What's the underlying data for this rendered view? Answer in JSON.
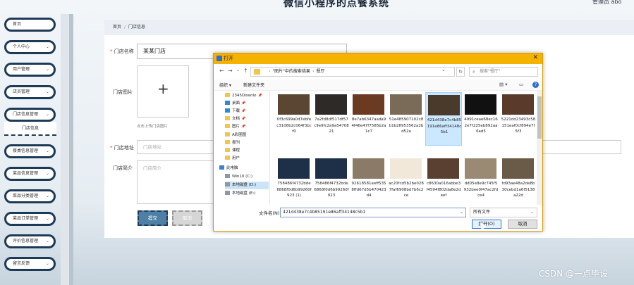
{
  "app": {
    "title": "微信小程序的点餐系统",
    "admin": "管理员 abo"
  },
  "sidebar": {
    "items": [
      {
        "label": "首页",
        "chevron": ""
      },
      {
        "label": "个人中心",
        "chevron": "⌄"
      },
      {
        "label": "用户管理",
        "chevron": "⌄"
      },
      {
        "label": "店员管理",
        "chevron": "⌄"
      },
      {
        "label": "门店信息管理",
        "chevron": "⌄"
      },
      {
        "label": "餐桌信息管理",
        "chevron": "⌄"
      },
      {
        "label": "菜品信息管理",
        "chevron": "⌄"
      },
      {
        "label": "菜品分类管理",
        "chevron": "⌄"
      },
      {
        "label": "菜品订单管理",
        "chevron": "⌄"
      },
      {
        "label": "评价信息管理",
        "chevron": "⌄"
      },
      {
        "label": "留言反馈",
        "chevron": "⌄"
      }
    ],
    "sub_item": "门店信息"
  },
  "breadcrumb": {
    "home": "首页",
    "sep": "/",
    "current": "门店信息"
  },
  "form": {
    "name_label": "门店名称",
    "name_value": "某某门店",
    "image_label": "门店图片",
    "upload_plus": "+",
    "upload_hint": "点击上传门店图片",
    "address_label": "门店地址",
    "address_placeholder": "门店地址",
    "intro_label": "门店简介",
    "intro_placeholder": "门店简介",
    "required_mark": "*",
    "submit": "提交",
    "cancel": "取消"
  },
  "dialog": {
    "title": "打开",
    "close": "✕",
    "nav": {
      "back": "←",
      "forward": "→",
      "dropdown": "⌄",
      "up": "↑"
    },
    "path": [
      "\"图片\"中的搜索结果",
      "餐厅"
    ],
    "path_sep": "›",
    "refresh": "↻",
    "search_placeholder": "搜索\"餐厅\"",
    "search_icon": "⌕",
    "toolbar": {
      "organize": "组织 ▾",
      "new_folder": "新建文件夹",
      "view": "▤ ▾",
      "pane": "▭",
      "help": "?"
    },
    "nav_items": [
      {
        "label": "2345Downlo",
        "icon": "folder",
        "pin": "📌",
        "indent": 1,
        "selected": false
      },
      {
        "label": "桌面",
        "icon": "blue",
        "pin": "📌",
        "indent": 1,
        "selected": false
      },
      {
        "label": "下载",
        "icon": "blue",
        "pin": "📌",
        "indent": 1,
        "selected": false
      },
      {
        "label": "文档",
        "icon": "folder",
        "pin": "📌",
        "indent": 1,
        "selected": false
      },
      {
        "label": "图片",
        "icon": "folder",
        "pin": "📌",
        "indent": 1,
        "selected": false
      },
      {
        "label": "A彩圈图",
        "icon": "folder",
        "pin": "",
        "indent": 1,
        "selected": false
      },
      {
        "label": "报刊",
        "icon": "folder",
        "pin": "",
        "indent": 1,
        "selected": false
      },
      {
        "label": "课程",
        "icon": "folder",
        "pin": "",
        "indent": 1,
        "selected": false
      },
      {
        "label": "用户",
        "icon": "folder",
        "pin": "",
        "indent": 1,
        "selected": false
      },
      {
        "label": "此电脑",
        "icon": "pc",
        "pin": "",
        "indent": 0,
        "selected": false
      },
      {
        "label": "Win10 (C:)",
        "icon": "drive",
        "pin": "",
        "indent": 1,
        "selected": false
      },
      {
        "label": "本地磁盘 (D:)",
        "icon": "drive",
        "pin": "",
        "indent": 1,
        "selected": true
      },
      {
        "label": "本地磁盘 (E:)",
        "icon": "drive",
        "pin": "",
        "indent": 1,
        "selected": false
      }
    ],
    "thumbnails": [
      {
        "caption": "0f3c699a0d7ebfec3108b2c064f3bcf0",
        "color": "#5a4632",
        "selected": false
      },
      {
        "caption": "7a2fd8df517df57c9e9fc2a9a5470821",
        "color": "#2e2a28",
        "selected": false
      },
      {
        "caption": "8e7ab6347aada94f46e47f7585b2a1c7",
        "color": "#6b3a22",
        "selected": false
      },
      {
        "caption": "51e485907102c8b1b28953562a2bd52a",
        "color": "#7a6a58",
        "selected": false
      },
      {
        "caption": "421d438e7c4b85191e86aff34148c5b1",
        "color": "#4a3a2c",
        "selected": true
      },
      {
        "caption": "4991ceae68ec162e7f225eb892aa6ad5",
        "color": "#111111",
        "selected": false
      },
      {
        "caption": "5221dd23493c58151eaf0cf894e7f5f3",
        "color": "#5a3a2a",
        "selected": false
      },
      {
        "caption": "758486f4732bde6868f0d6b99260f923 (1)",
        "color": "#1e3048",
        "selected": false
      },
      {
        "caption": "758486f4732bde6868f0d6b99260f923",
        "color": "#1e3048",
        "selected": false
      },
      {
        "caption": "92618581eeff5358ffd67d5b470423d4",
        "color": "#8a7a66",
        "selected": false
      },
      {
        "caption": "ac20fcd5b2be0287faf6908bd7b6c2ce",
        "color": "#f1e8da",
        "selected": false
      },
      {
        "caption": "c8630a016abbe3f4594f802da8e2deef",
        "color": "#5a4030",
        "selected": false
      },
      {
        "caption": "dd05e8e9c745f5932bee0f47ac2fdce4",
        "color": "#9a8a74",
        "selected": false
      },
      {
        "caption": "fd93ae48a2de8b30cebd1a6f5138a22d",
        "color": "#6a5a48",
        "selected": false
      }
    ],
    "filename_label": "文件名(N):",
    "filename_value": "421d438e7c4b85191e86aff34148c5b1",
    "filename_drop": "⌄",
    "filetype": "所有文件",
    "filetype_drop": "⌄",
    "open": "打开(O)",
    "cancel": "取消"
  },
  "watermark": "CSDN @一点毕设"
}
